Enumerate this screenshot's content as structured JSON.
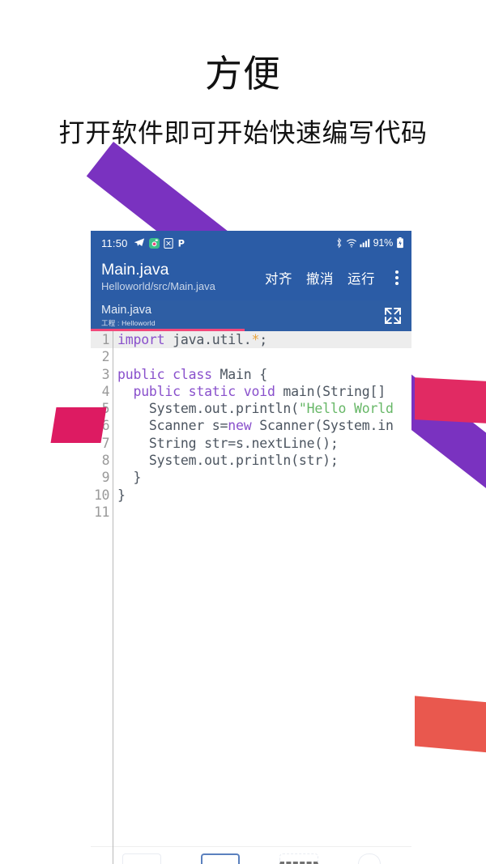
{
  "promo": {
    "title": "方便",
    "subtitle": "打开软件即可开始快速编写代码"
  },
  "colors": {
    "ribbon_purple": "#7A32C0",
    "ribbon_pink": "#DD1B62",
    "ribbon_red": "#E9584E",
    "app_bar_blue": "#2B5CA6",
    "tab_bar_blue": "#2E5EA4",
    "tab_underline_pink": "#F2487A",
    "keyword_purple": "#8950CC",
    "string_green": "#67B767",
    "asterisk_orange": "#E8A33D"
  },
  "phone": {
    "status_bar": {
      "time": "11:50",
      "left_icons": [
        "telegram-icon",
        "camera-icon",
        "image-app-icon",
        "p-app-icon"
      ],
      "right_icons": [
        "bluetooth-icon",
        "wifi-icon",
        "signal-icon",
        "battery-icon"
      ],
      "battery_percent": "91%"
    },
    "app_bar": {
      "title": "Main.java",
      "subtitle": "Helloworld/src/Main.java",
      "actions": [
        {
          "label": "对齐",
          "name": "align-button"
        },
        {
          "label": "撤消",
          "name": "undo-button"
        },
        {
          "label": "运行",
          "name": "run-button"
        }
      ],
      "overflow_icon": "overflow-menu-icon"
    },
    "editor_tab": {
      "filename": "Main.java",
      "project": "工程 : Helloworld",
      "expand_icon": "fullscreen-expand-icon"
    },
    "editor": {
      "active_line": 1,
      "lines": [
        {
          "n": "1",
          "html": "<span class=\"kw\">import</span> java.util.<span class=\"ast\">*</span>;"
        },
        {
          "n": "2",
          "html": ""
        },
        {
          "n": "3",
          "html": "<span class=\"kw\">public class</span> Main {"
        },
        {
          "n": "4",
          "html": "  <span class=\"kw\">public static void</span> main(String[]"
        },
        {
          "n": "5",
          "html": "    System.out.println(<span class=\"str\">\"Hello World</span>"
        },
        {
          "n": "6",
          "html": "    Scanner s=<span class=\"kw\">new</span> Scanner(System.in"
        },
        {
          "n": "7",
          "html": "    String str=s.nextLine();"
        },
        {
          "n": "8",
          "html": "    System.out.println(str);"
        },
        {
          "n": "9",
          "html": "  }"
        },
        {
          "n": "10",
          "html": "}"
        },
        {
          "n": "11",
          "html": ""
        }
      ],
      "plain_lines": [
        "import java.util.*;",
        "",
        "public class Main {",
        "  public static void main(String[]",
        "    System.out.println(\"Hello World",
        "    Scanner s=new Scanner(System.in",
        "    String str=s.nextLine();",
        "    System.out.println(str);",
        "  }",
        "}",
        ""
      ]
    },
    "bottom_toolbar": {
      "buttons": [
        "toolbar-button-1",
        "toolbar-button-2",
        "toolbar-button-3",
        "toolbar-button-4"
      ]
    }
  }
}
